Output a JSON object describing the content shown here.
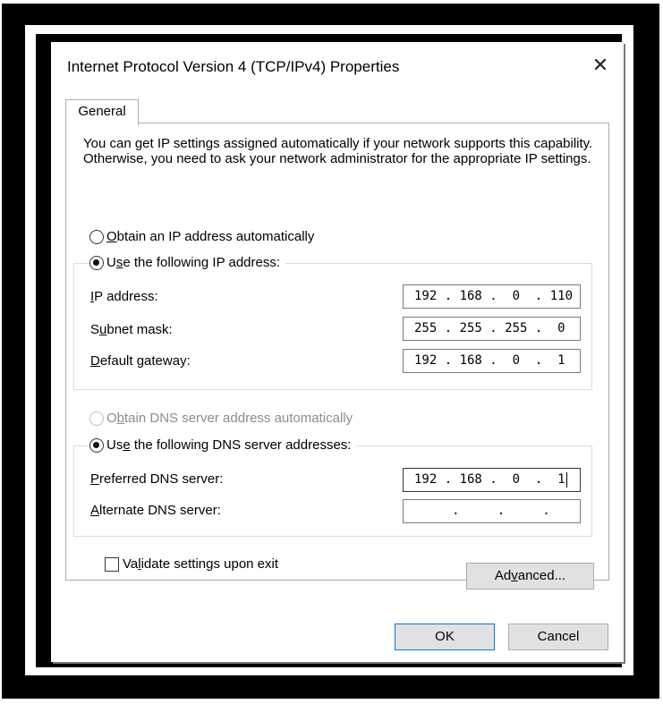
{
  "window": {
    "title": "Internet Protocol Version 4 (TCP/IPv4) Properties",
    "close_glyph": "✕"
  },
  "tabs": [
    {
      "label": "General"
    }
  ],
  "description": "You can get IP settings assigned automatically if your network supports this capability. Otherwise, you need to ask your network administrator for the appropriate IP settings.",
  "ip_mode": {
    "auto_option": {
      "pre": "",
      "key": "O",
      "post": "btain an IP address automatically",
      "checked": false
    },
    "manual_option": {
      "pre": "U",
      "key": "s",
      "post": "e the following IP address:",
      "checked": true
    }
  },
  "ip_fields": [
    {
      "label_pre": "",
      "key": "I",
      "label_post": "P address:",
      "value": "192 . 168 .  0  . 110"
    },
    {
      "label_pre": "S",
      "key": "u",
      "label_post": "bnet mask:",
      "value": "255 . 255 . 255 .  0"
    },
    {
      "label_pre": "",
      "key": "D",
      "label_post": "efault gateway:",
      "value": "192 . 168 .  0  .  1"
    }
  ],
  "dns_mode": {
    "auto_option": {
      "pre": "O",
      "key": "b",
      "post": "tain DNS server address automatically",
      "checked": false,
      "disabled": true
    },
    "manual_option": {
      "pre": "Us",
      "key": "e",
      "post": " the following DNS server addresses:",
      "checked": true
    }
  },
  "dns_fields": [
    {
      "label_pre": "",
      "key": "P",
      "label_post": "referred DNS server:",
      "value": "192 . 168 .  0  .  1",
      "focused": true
    },
    {
      "label_pre": "",
      "key": "A",
      "label_post": "lternate DNS server:",
      "value": "     .     .     .",
      "focused": false
    }
  ],
  "validate": {
    "pre": "Va",
    "key": "l",
    "post": "idate settings upon exit",
    "checked": false
  },
  "buttons": {
    "advanced": {
      "pre": "Ad",
      "key": "v",
      "post": "anced..."
    },
    "ok": "OK",
    "cancel": "Cancel"
  }
}
